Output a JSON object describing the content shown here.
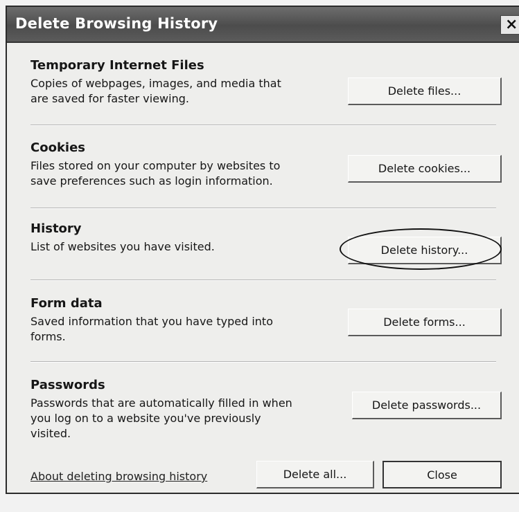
{
  "window": {
    "title": "Delete Browsing History",
    "close_glyph": "×"
  },
  "sections": [
    {
      "title": "Temporary Internet Files",
      "desc_lines": [
        "Copies of webpages, images, and media that",
        "are saved for faster viewing."
      ],
      "button": "Delete files..."
    },
    {
      "title": "Cookies",
      "desc_lines": [
        "Files stored on your computer by websites to",
        "save preferences such as login information."
      ],
      "button": "Delete cookies..."
    },
    {
      "title": "History",
      "desc_lines": [
        "List of websites you have visited."
      ],
      "button": "Delete history..."
    },
    {
      "title": "Form data",
      "desc_lines": [
        "Saved information that you have typed into",
        "forms."
      ],
      "button": "Delete forms..."
    },
    {
      "title": "Passwords",
      "desc_lines": [
        "Passwords that are automatically filled in when",
        "you log on to a website you've previously",
        "visited."
      ],
      "button": "Delete passwords..."
    }
  ],
  "footer": {
    "link": "About deleting browsing history",
    "delete_all": "Delete all...",
    "close": "Close"
  }
}
